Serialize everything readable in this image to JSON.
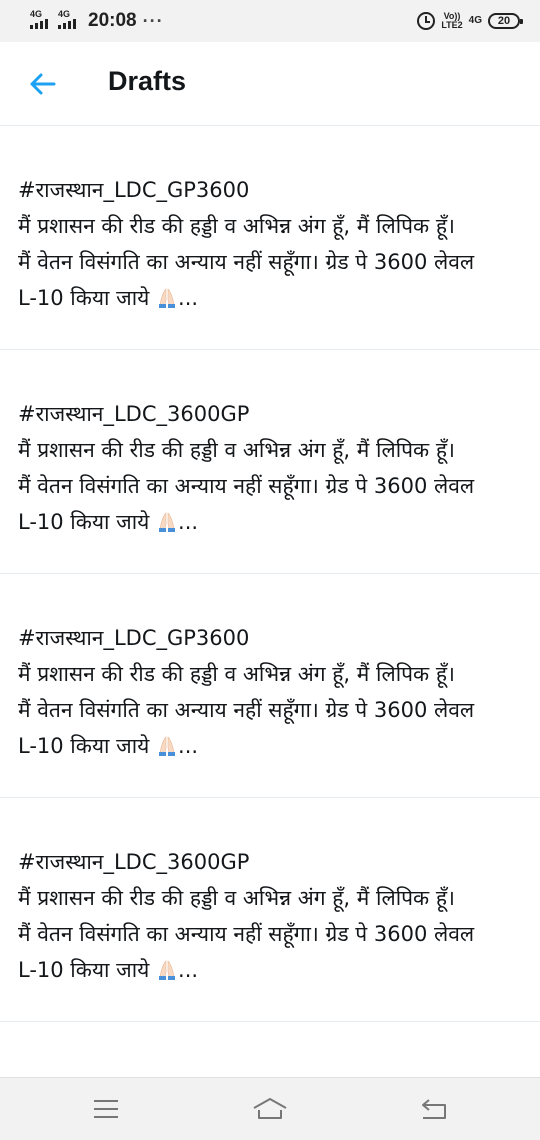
{
  "status_bar": {
    "sim1_network": "4G",
    "sim2_network": "4G",
    "time": "20:08",
    "overflow": "···",
    "volte_line1": "Vo))",
    "volte_line2": "LTE2",
    "network_right": "4G",
    "battery": "20",
    "icons": [
      "signal-icon",
      "signal-icon",
      "alarm-icon",
      "volte-icon",
      "battery-icon"
    ]
  },
  "header": {
    "title": "Drafts",
    "back_icon": "back-arrow-icon",
    "accent_color": "#1da1f2"
  },
  "drafts": [
    {
      "text": "#राजस्थान_LDC_GP3600\nमैं प्रशासन की रीड की हड्डी व अभिन्न अंग हूँ, मैं लिपिक हूँ।\nमैं वेतन विसंगति का अन्याय नहीं सहूँगा। ग्रेड पे 3600 लेवल\nL-10 किया जाये ",
      "ellipsis": "...",
      "emoji": "folded-hands-icon"
    },
    {
      "text": "#राजस्थान_LDC_3600GP\nमैं प्रशासन की रीड की हड्डी व अभिन्न अंग हूँ, मैं लिपिक हूँ।\nमैं वेतन विसंगति का अन्याय नहीं सहूँगा। ग्रेड पे 3600 लेवल\nL-10 किया जाये ",
      "ellipsis": "...",
      "emoji": "folded-hands-icon"
    },
    {
      "text": "#राजस्थान_LDC_GP3600\nमैं प्रशासन की रीड की हड्डी व अभिन्न अंग हूँ, मैं लिपिक हूँ।\nमैं वेतन विसंगति का अन्याय नहीं सहूँगा। ग्रेड पे 3600 लेवल\nL-10 किया जाये ",
      "ellipsis": "...",
      "emoji": "folded-hands-icon"
    },
    {
      "text": "#राजस्थान_LDC_3600GP\nमैं प्रशासन की रीड की हड्डी व अभिन्न अंग हूँ, मैं लिपिक हूँ।\nमैं वेतन विसंगति का अन्याय नहीं सहूँगा। ग्रेड पे 3600 लेवल\nL-10 किया जाये ",
      "ellipsis": "...",
      "emoji": "folded-hands-icon"
    }
  ],
  "nav_bar": {
    "icons": [
      "menu-icon",
      "home-icon",
      "back-icon"
    ]
  }
}
